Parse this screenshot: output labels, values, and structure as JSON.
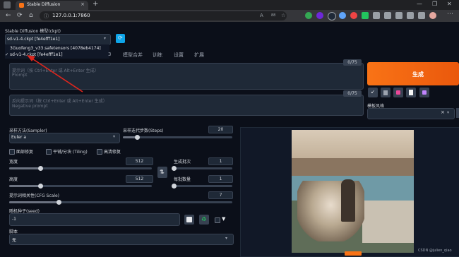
{
  "browser": {
    "tab_title": "Stable Diffusion",
    "url": "127.0.0.1:7860",
    "zoom_text": "88"
  },
  "app": {
    "checkpoint_label": "Stable Diffusion 模型(ckpt)",
    "checkpoint_value": "sd-v1-4.ckpt [fe4efff1e1]",
    "dropdown_options": [
      "3Guofeng3_v33.safetensors [4078eb4174]",
      "sd-v1-4.ckpt [fe4efff1e1]"
    ],
    "tabs": [
      "3",
      "模型合并",
      "训练",
      "设置",
      "扩展"
    ],
    "prompt_placeholder": "提示词（按 Ctrl+Enter 或 Alt+Enter 生成）",
    "prompt_placeholder_en": "Prompt",
    "prompt_counter": "0/75",
    "neg_placeholder": "反向提示词（按 Ctrl+Enter 或 Alt+Enter 生成）",
    "neg_placeholder_en": "Negative prompt",
    "neg_counter": "0/75",
    "generate_label": "生成",
    "style_label": "模板风格",
    "sampler_label": "采样方法(Sampler)",
    "sampler_value": "Euler a",
    "steps_label": "采样迭代步数(Steps)",
    "steps_value": "20",
    "steps_fraction": 0.13,
    "checkbox_face": "面部修复",
    "checkbox_tiling": "平铺/分块 (Tiling)",
    "checkbox_hires": "高清修复",
    "width_label": "宽度",
    "width_value": "512",
    "width_fraction": 0.22,
    "height_label": "高度",
    "height_value": "512",
    "height_fraction": 0.22,
    "batch_count_label": "生成批次",
    "batch_count_value": "1",
    "batch_count_fraction": 0.0,
    "batch_size_label": "每批数量",
    "batch_size_value": "1",
    "batch_size_fraction": 0.0,
    "cfg_label": "提示词相关性(CFG Scale)",
    "cfg_value": "7",
    "cfg_fraction": 0.22,
    "seed_label": "随机种子(seed)",
    "seed_value": "-1",
    "script_label": "脚本",
    "script_value": "无",
    "watermark": "CSDN @julien_qiao",
    "colors": {
      "accent": "#f97316",
      "arrow": "#e0261d",
      "bg": "#0b0f19",
      "panel": "#1f2937"
    }
  }
}
